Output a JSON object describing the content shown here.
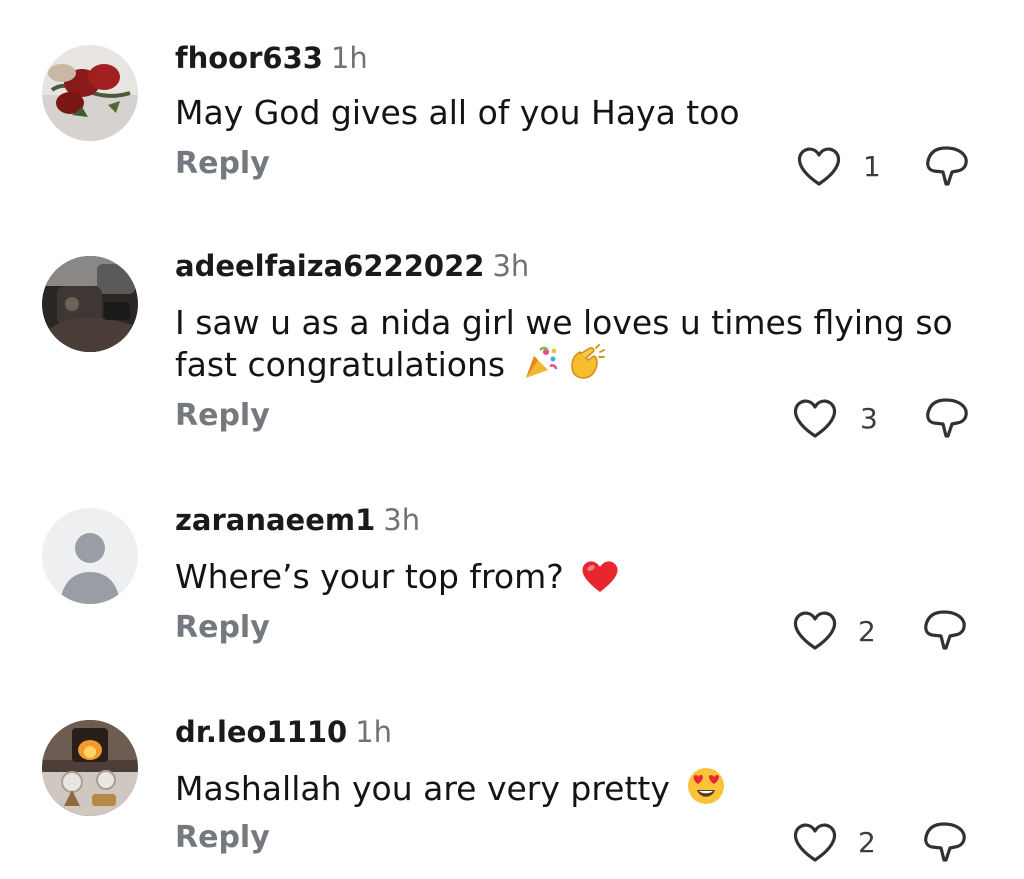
{
  "comments": [
    {
      "username": "fhoor633",
      "time": "1h",
      "text": "May God gives all of you Haya too",
      "emoji": [],
      "reply_label": "Reply",
      "likes": "1",
      "avatar": "photo-red-roses"
    },
    {
      "username": "adeelfaiza6222022",
      "time": "3h",
      "text": "I saw u as a nida girl we loves u times flying so fast congratulations",
      "emoji": [
        "party-popper",
        "clapping-hands"
      ],
      "reply_label": "Reply",
      "likes": "3",
      "avatar": "photo-car-interior"
    },
    {
      "username": "zaranaeem1",
      "time": "3h",
      "text": "Where’s your top from?",
      "emoji": [
        "red-heart"
      ],
      "reply_label": "Reply",
      "likes": "2",
      "avatar": "default-person"
    },
    {
      "username": "dr.leo1110",
      "time": "1h",
      "text": "Mashallah you are very pretty",
      "emoji": [
        "heart-eyes"
      ],
      "reply_label": "Reply",
      "likes": "2",
      "avatar": "photo-fireplace-table"
    }
  ],
  "colors": {
    "username": "#1a1a1a",
    "timestamp": "#6f7378",
    "reply": "#75797e",
    "icon_stroke": "#2f3236",
    "default_avatar_bg": "#eeeff1",
    "default_avatar_fg": "#9a9ea4"
  },
  "icons": [
    "heart-outline-icon",
    "dislike-icon"
  ]
}
